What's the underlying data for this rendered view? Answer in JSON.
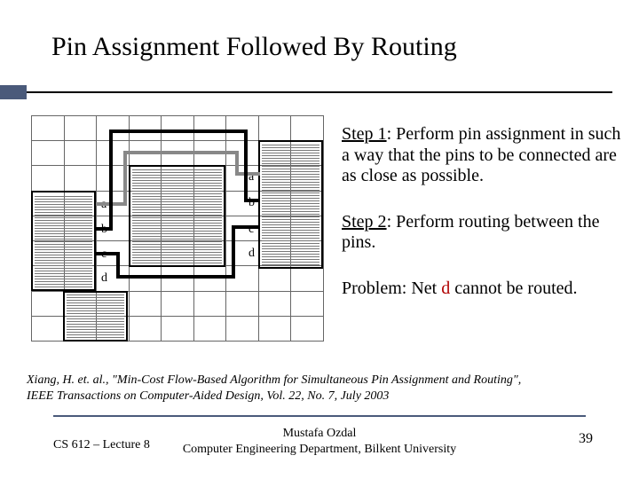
{
  "title": "Pin Assignment Followed By Routing",
  "steps": {
    "s1_label": "Step 1",
    "s1_body": ": Perform pin assignment in such a way that the pins to be connected are as close as possible.",
    "s2_label": "Step 2",
    "s2_body": ": Perform routing between the pins.",
    "problem_prefix": "Problem: Net ",
    "problem_net": "d",
    "problem_suffix": " cannot be routed."
  },
  "citation_line1": "Xiang, H. et. al., \"Min-Cost Flow-Based Algorithm for Simultaneous Pin Assignment and Routing\",",
  "citation_line2": "IEEE Transactions on Computer-Aided Design, Vol. 22, No. 7, July 2003",
  "footer": {
    "left": "CS 612 – Lecture 8",
    "center1": "Mustafa Ozdal",
    "center2": "Computer Engineering Department, Bilkent University",
    "page": "39"
  },
  "pins": {
    "a": "a",
    "b": "b",
    "c": "c",
    "d": "d"
  }
}
